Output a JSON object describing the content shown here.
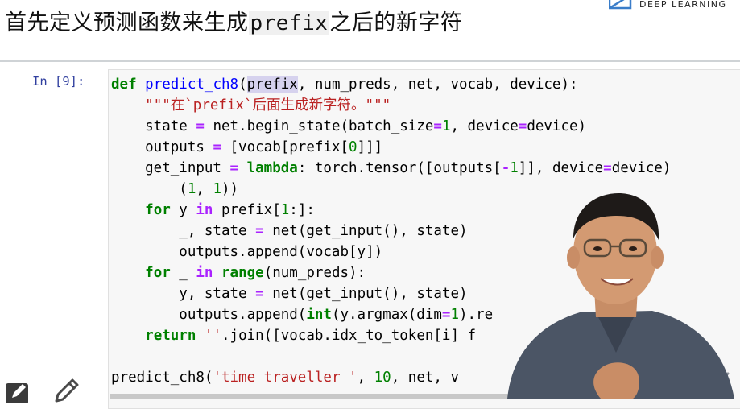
{
  "heading": {
    "before": "首先定义预测函数来生成",
    "code": "prefix",
    "after": "之后的新字符"
  },
  "brand": {
    "text": "DEEP LEARNING"
  },
  "cell": {
    "prompt": "In [9]:",
    "lines": [
      [
        [
          "kw",
          "def"
        ],
        [
          "t",
          " "
        ],
        [
          "fn",
          "predict_ch8"
        ],
        [
          "t",
          "("
        ],
        [
          "hl",
          "prefix"
        ],
        [
          "t",
          ", num_preds, net, vocab, device):"
        ]
      ],
      [
        [
          "t",
          "    "
        ],
        [
          "str",
          "\"\"\"在`prefix`后面生成新字符。\"\"\""
        ]
      ],
      [
        [
          "t",
          "    state "
        ],
        [
          "op",
          "="
        ],
        [
          "t",
          " net.begin_state(batch_size"
        ],
        [
          "op",
          "="
        ],
        [
          "num",
          "1"
        ],
        [
          "t",
          ", device"
        ],
        [
          "op",
          "="
        ],
        [
          "t",
          "device)"
        ]
      ],
      [
        [
          "t",
          "    outputs "
        ],
        [
          "op",
          "="
        ],
        [
          "t",
          " [vocab[prefix["
        ],
        [
          "num",
          "0"
        ],
        [
          "t",
          "]]]"
        ]
      ],
      [
        [
          "t",
          "    get_input "
        ],
        [
          "op",
          "="
        ],
        [
          "t",
          " "
        ],
        [
          "kw",
          "lambda"
        ],
        [
          "t",
          ": torch.tensor([outputs["
        ],
        [
          "op",
          "-"
        ],
        [
          "num",
          "1"
        ],
        [
          "t",
          "]], device"
        ],
        [
          "op",
          "="
        ],
        [
          "t",
          "device)"
        ]
      ],
      [
        [
          "t",
          "        ("
        ],
        [
          "num",
          "1"
        ],
        [
          "t",
          ", "
        ],
        [
          "num",
          "1"
        ],
        [
          "t",
          "))"
        ]
      ],
      [
        [
          "t",
          "    "
        ],
        [
          "kw",
          "for"
        ],
        [
          "t",
          " y "
        ],
        [
          "op",
          "in"
        ],
        [
          "t",
          " prefix["
        ],
        [
          "num",
          "1"
        ],
        [
          "t",
          ":]:"
        ]
      ],
      [
        [
          "t",
          "        _, state "
        ],
        [
          "op",
          "="
        ],
        [
          "t",
          " net(get_input(), state)"
        ]
      ],
      [
        [
          "t",
          "        outputs.append(vocab[y])"
        ]
      ],
      [
        [
          "t",
          "    "
        ],
        [
          "kw",
          "for"
        ],
        [
          "t",
          " _ "
        ],
        [
          "op",
          "in"
        ],
        [
          "t",
          " "
        ],
        [
          "kw",
          "range"
        ],
        [
          "t",
          "(num_preds):"
        ]
      ],
      [
        [
          "t",
          "        y, state "
        ],
        [
          "op",
          "="
        ],
        [
          "t",
          " net(get_input(), state)"
        ]
      ],
      [
        [
          "t",
          "        outputs.append("
        ],
        [
          "kw",
          "int"
        ],
        [
          "t",
          "(y.argmax(dim"
        ],
        [
          "op",
          "="
        ],
        [
          "num",
          "1"
        ],
        [
          "t",
          ").re"
        ]
      ],
      [
        [
          "t",
          "    "
        ],
        [
          "kw",
          "return"
        ],
        [
          "t",
          " "
        ],
        [
          "str",
          "''"
        ],
        [
          "t",
          ".join([vocab.idx_to_token[i] f"
        ]
      ],
      [
        [
          "t",
          ""
        ]
      ],
      [
        [
          "t",
          "predict_ch8("
        ],
        [
          "str",
          "'time traveller '"
        ],
        [
          "t",
          ", "
        ],
        [
          "num",
          "10"
        ],
        [
          "t",
          ", net, v"
        ]
      ]
    ]
  },
  "colors": {
    "keyword": "#008000",
    "function": "#0000ff",
    "string": "#ba2121",
    "number": "#008000",
    "operator": "#aa22ff",
    "prompt": "#303f9f"
  },
  "icons": {
    "edit": "edit-icon",
    "pencil": "pencil-icon",
    "nav": "chevron-left-icon",
    "logo": "deep-learning-logo"
  }
}
